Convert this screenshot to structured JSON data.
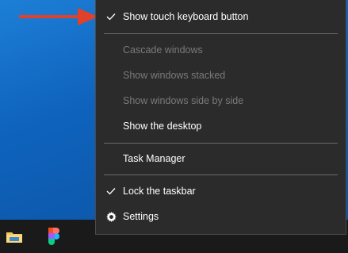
{
  "menu": {
    "items": [
      {
        "label": "Show touch keyboard button",
        "checked": true,
        "enabled": true
      },
      {
        "label": "Cascade windows",
        "checked": false,
        "enabled": false
      },
      {
        "label": "Show windows stacked",
        "checked": false,
        "enabled": false
      },
      {
        "label": "Show windows side by side",
        "checked": false,
        "enabled": false
      },
      {
        "label": "Show the desktop",
        "checked": false,
        "enabled": true
      },
      {
        "label": "Task Manager",
        "checked": false,
        "enabled": true
      },
      {
        "label": "Lock the taskbar",
        "checked": true,
        "enabled": true
      },
      {
        "label": "Settings",
        "icon": "gear-icon",
        "enabled": true
      }
    ]
  },
  "taskbar": {
    "pinned": [
      {
        "icon": "file-explorer-icon"
      },
      {
        "icon": "figma-icon"
      }
    ]
  },
  "colors": {
    "menu_background": "#2b2b2b",
    "disabled_text": "#7a7a7a",
    "annotation_arrow": "#e0412b",
    "taskbar": "#1a1a1a"
  }
}
